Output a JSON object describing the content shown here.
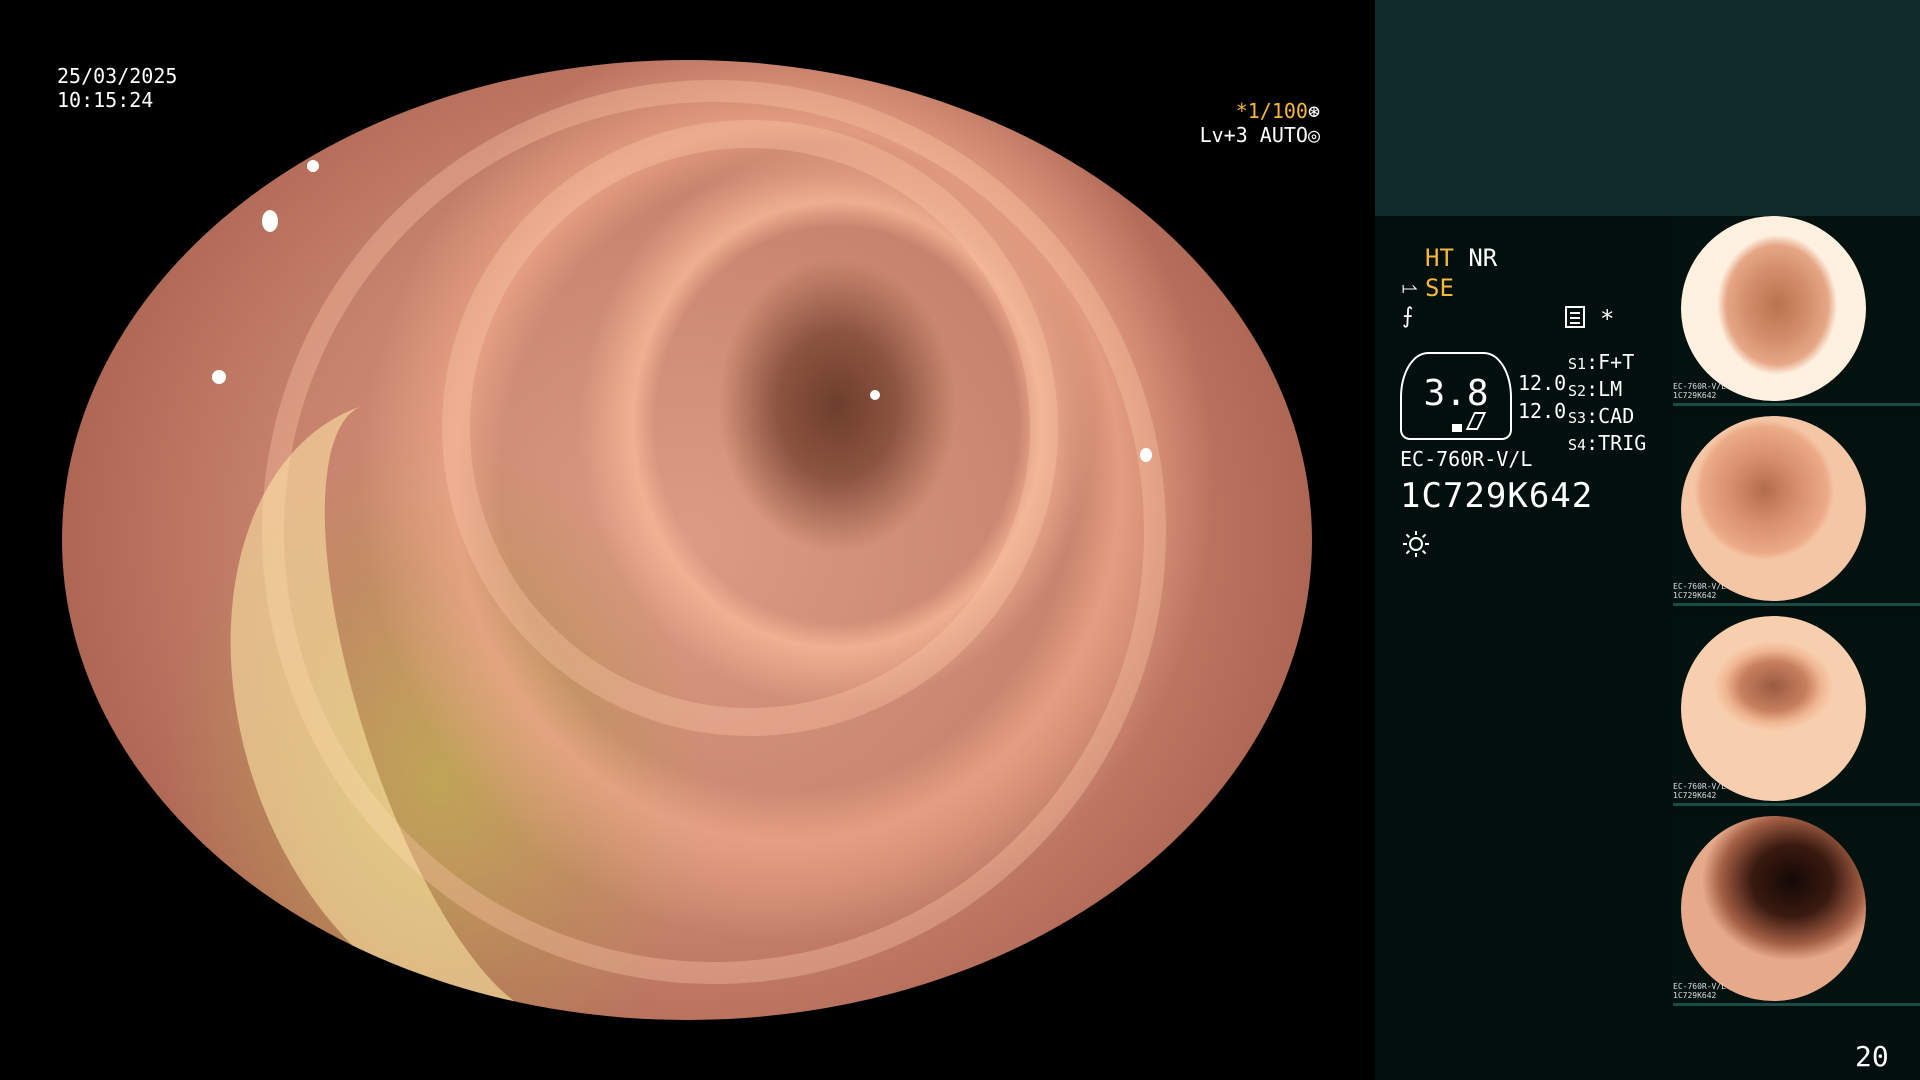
{
  "overlay": {
    "date": "25/03/2025",
    "time": "10:15:24",
    "shutter": "*1/100",
    "shutter_icon": "aperture-icon",
    "iris": "Lv+3 AUTO",
    "iris_icon": "iris-icon"
  },
  "panel": {
    "mode_hl_1": "HT",
    "mode_1": "NR",
    "mode_hl_2": "SE",
    "star": "*",
    "hex_value": "3.8",
    "num_1": "12.0",
    "num_2": "12.0",
    "slots": [
      {
        "key": "S1",
        "value": "F+T"
      },
      {
        "key": "S2",
        "value": "LM"
      },
      {
        "key": "S3",
        "value": "CAD"
      },
      {
        "key": "S4",
        "value": "TRIG"
      }
    ],
    "model": "EC-760R-V/L",
    "serial": "1C729K642",
    "light_icon": "sun-icon"
  },
  "thumbnails": [
    {
      "label_model": "EC-760R-V/L",
      "label_serial": "1C729K642"
    },
    {
      "label_model": "EC-760R-V/L",
      "label_serial": "1C729K642"
    },
    {
      "label_model": "EC-760R-V/L",
      "label_serial": "1C729K642"
    },
    {
      "label_model": "EC-760R-V/L",
      "label_serial": "1C729K642"
    }
  ],
  "page_number": "20",
  "colors": {
    "accent": "#f5b83c",
    "panel_bg": "#020f0d",
    "panel_top": "#10292a"
  }
}
